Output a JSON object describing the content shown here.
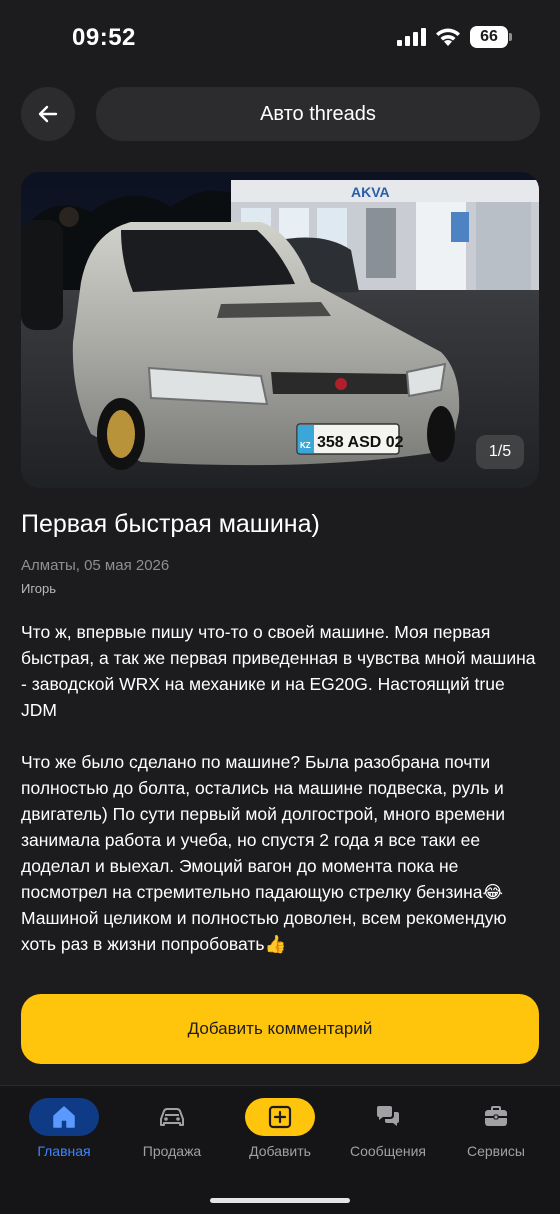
{
  "status_bar": {
    "time": "09:52",
    "battery": "66"
  },
  "header": {
    "title": "Авто threads",
    "back_icon": "arrow-left-icon"
  },
  "photo": {
    "counter": "1/5",
    "plate": "358 ASD 02",
    "plate_region": "KZ",
    "sign": "AKVA"
  },
  "post": {
    "title": "Первая быстрая машина)",
    "meta": "Алматы, 05 мая 2026",
    "author": "Игорь",
    "body": [
      "Что ж, впервые пишу что-то о своей машине. Моя первая быстрая, а так же первая приведенная в чувства мной машина - заводской WRX на механике и на EG20G. Настоящий true JDM",
      "Что же было сделано по машине? Была разобрана почти полностью до болта, остались на машине подвеска, руль и двигатель) По сути первый мой долгострой, много времени занимала работа и учеба, но спустя 2 года я все таки ее доделал и выехал. Эмоций вагон до момента пока не посмотрел на стремительно падающую стрелку бензина😂  Машиной целиком и полностью доволен, всем рекомендую хоть раз в жизни попробовать👍"
    ]
  },
  "comment_button": {
    "label": "Добавить комментарий"
  },
  "nav": {
    "items": [
      {
        "label": "Главная",
        "icon": "home-icon",
        "active": true
      },
      {
        "label": "Продажа",
        "icon": "car-icon",
        "active": false
      },
      {
        "label": "Добавить",
        "icon": "plus-square-icon",
        "active": false
      },
      {
        "label": "Сообщения",
        "icon": "chat-bubbles-icon",
        "active": false
      },
      {
        "label": "Сервисы",
        "icon": "toolbox-icon",
        "active": false
      }
    ]
  },
  "colors": {
    "background": "#1c1c1e",
    "surface": "#2c2c2e",
    "accent_yellow": "#ffc40c",
    "active_blue": "#3d86ff",
    "active_pill": "#0f3a85"
  }
}
